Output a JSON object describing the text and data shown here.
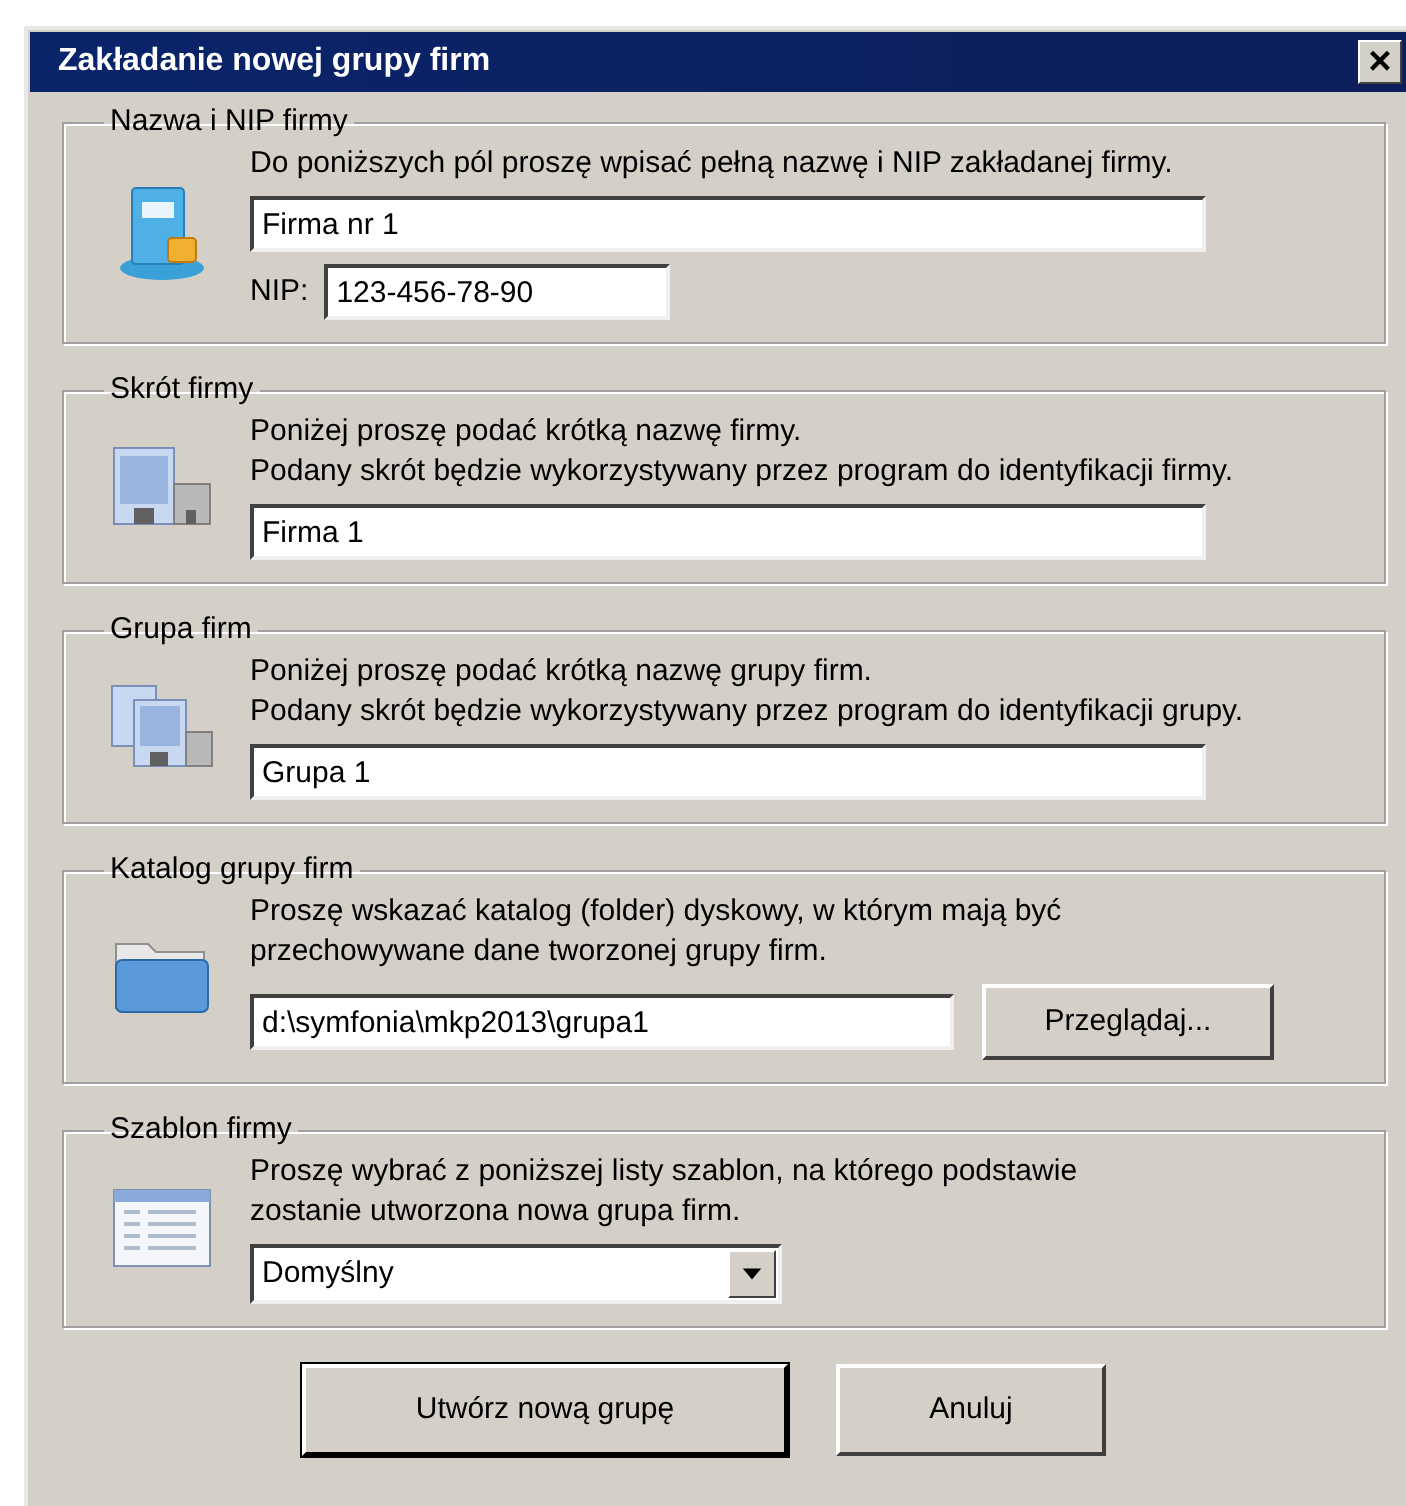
{
  "window": {
    "title": "Zakładanie nowej grupy firm",
    "close": "×"
  },
  "sections": [
    {
      "legend": "Nazwa i NIP firmy",
      "kind": "book",
      "lines": [
        "Do poniższych pól proszę wpisać pełną nazwę i NIP zakładanej firmy."
      ],
      "fields": [
        {
          "kind": "text",
          "value": "Firma nr 1"
        },
        {
          "kind": "labeled",
          "label": "NIP:",
          "value": "123-456-78-90"
        }
      ]
    },
    {
      "legend": "Skrót firmy",
      "kind": "building",
      "lines": [
        "Poniżej proszę podać krótką nazwę firmy.",
        "Podany skrót będzie wykorzystywany przez program do identyfikacji firmy."
      ],
      "fields": [
        {
          "kind": "text",
          "value": "Firma 1"
        }
      ]
    },
    {
      "legend": "Grupa firm",
      "kind": "buildings",
      "lines": [
        "Poniżej proszę podać krótką nazwę grupy firm.",
        "Podany skrót będzie wykorzystywany przez program do identyfikacji grupy."
      ],
      "fields": [
        {
          "kind": "text",
          "value": "Grupa 1"
        }
      ]
    },
    {
      "legend": "Katalog grupy firm",
      "kind": "folder",
      "lines": [
        "Proszę wskazać katalog (folder) dyskowy, w którym mają być",
        "przechowywane dane tworzonej grupy firm."
      ],
      "fields": [
        {
          "kind": "browse",
          "value": "d:\\symfonia\\mkp2013\\grupa1",
          "button": "Przeglądaj..."
        }
      ]
    },
    {
      "legend": "Szablon firmy",
      "kind": "list",
      "lines": [
        "Proszę wybrać z poniższej listy szablon, na którego podstawie",
        "zostanie utworzona nowa grupa firm."
      ],
      "fields": [
        {
          "kind": "select",
          "value": "Domyślny"
        }
      ]
    }
  ],
  "buttons": [
    {
      "label": "Utwórz nową grupę",
      "default": true
    },
    {
      "label": "Anuluj",
      "default": false
    }
  ]
}
